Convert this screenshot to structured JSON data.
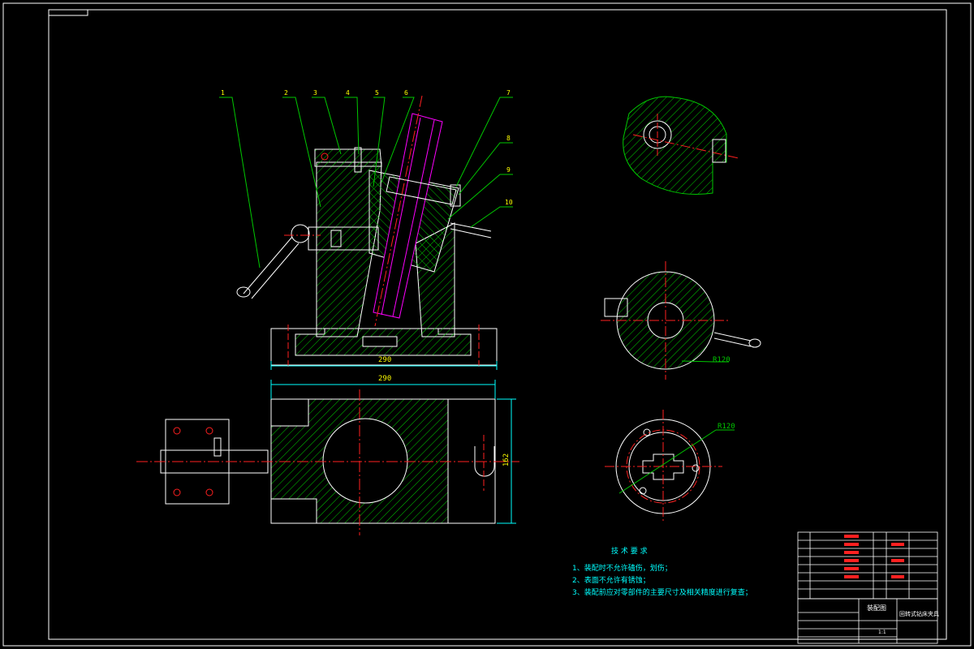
{
  "colors": {
    "background": "#000000",
    "frame": "#ffffff",
    "hatch": "#00c800",
    "leader": "#00c800",
    "centerline": "#ff2020",
    "dimension": "#00ffff",
    "magenta": "#ff00ff",
    "tech_text": "#00ffff",
    "balloon": "#ffff00"
  },
  "balloons": [
    "1",
    "2",
    "3",
    "4",
    "5",
    "6",
    "7",
    "8",
    "9",
    "10"
  ],
  "dimensions": {
    "front_width": "290",
    "top_width": "290",
    "top_height": "162",
    "radius_a": "R120",
    "radius_b": "R120"
  },
  "tech_requirements": {
    "title": "技 术 要 求",
    "items": [
      "1、装配时不允许磕伤，划伤；",
      "2、表面不允许有锈蚀；",
      "3、装配前应对零部件的主要尺寸及相关精度进行复查；"
    ]
  },
  "title_block": {
    "drawing_name": "装配图",
    "part_name": "回转式钻床夹具",
    "sheet": "1:1"
  }
}
